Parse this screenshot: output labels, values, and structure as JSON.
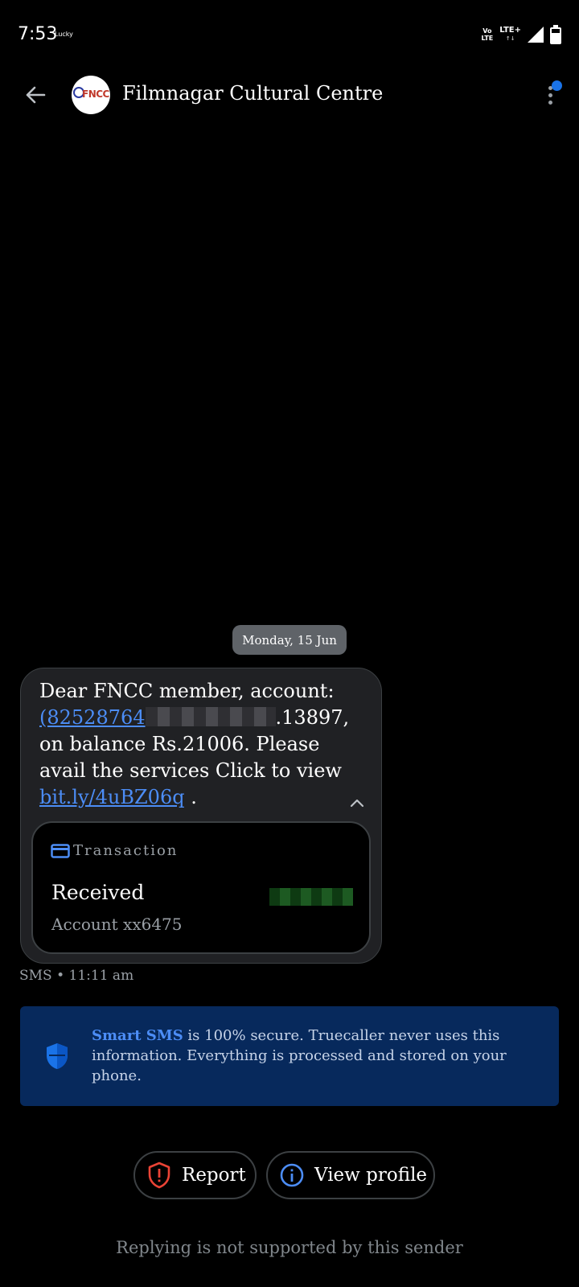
{
  "status_bar": {
    "time": "7:53",
    "carrier": "Lucky",
    "volte_top": "Vo",
    "volte_bottom": "LTE",
    "network": "LTE+",
    "network_arrows": "↑↓"
  },
  "header": {
    "avatar_text": "FNCC",
    "sender_name": "Filmnagar Cultural Centre"
  },
  "conversation": {
    "date_chip": "Monday, 15 Jun",
    "message": {
      "line1": "Dear FNCC member, account:",
      "link_number": "(82528764",
      "number_suffix": ".13897,",
      "line3": "on balance Rs.21006. Please",
      "line4": "avail the services Click to view",
      "link_url": "bit.ly/4uBZ06q",
      "trailing": " ."
    },
    "transaction": {
      "title": "Transaction",
      "status": "Received",
      "account": "Account xx6475"
    },
    "meta": "SMS • 11:11 am"
  },
  "info": {
    "brand": "Smart SMS",
    "text": " is 100% secure. Truecaller never uses this information. Everything is processed and stored on your phone."
  },
  "actions": {
    "report_label": "Report",
    "profile_label": "View profile"
  },
  "reply_note": "Replying is not supported by this sender",
  "colors": {
    "background": "#000000",
    "bubble": "#202124",
    "link": "#4c8df6",
    "info_background": "#07295c",
    "report_icon": "#ea4335",
    "profile_icon": "#4c8df6",
    "notification_dot": "#1a73e8"
  }
}
